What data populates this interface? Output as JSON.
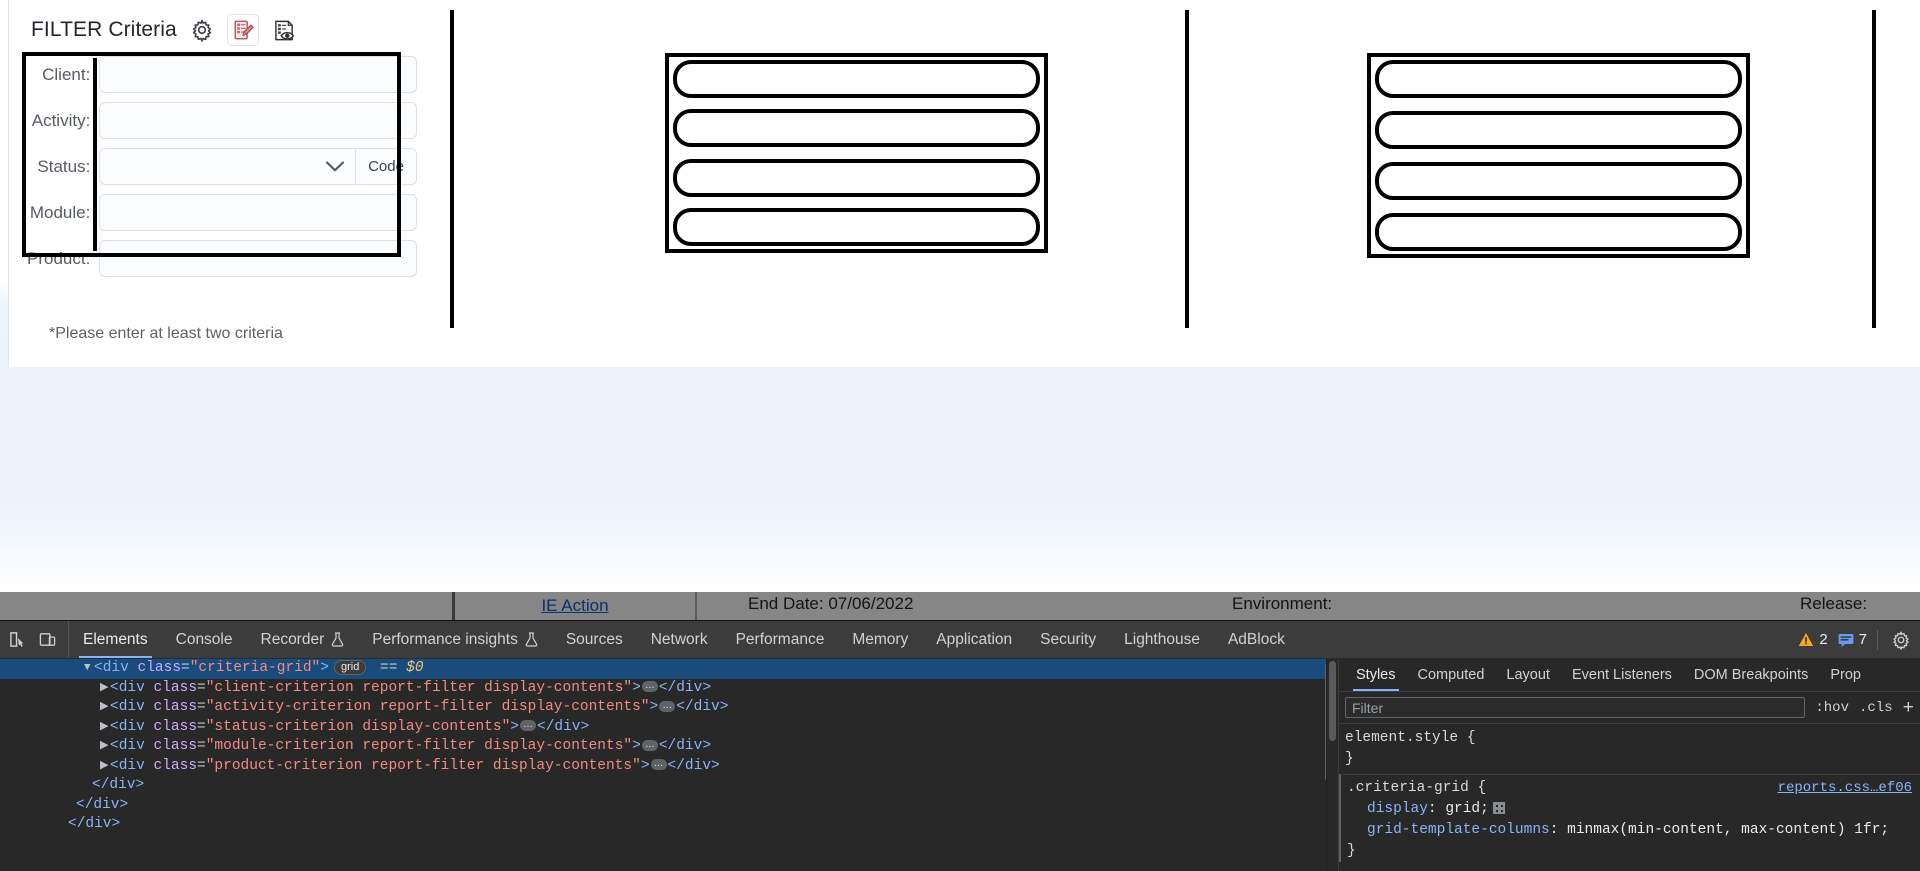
{
  "page": {
    "filter_panel": {
      "title": "FILTER Criteria",
      "icons": [
        {
          "name": "gear-icon",
          "label": "Settings"
        },
        {
          "name": "edit-report-icon",
          "label": "Edit"
        },
        {
          "name": "preview-report-icon",
          "label": "Preview"
        }
      ],
      "criteria": [
        {
          "label": "Client:",
          "type": "text",
          "value": "",
          "placeholder": ""
        },
        {
          "label": "Activity:",
          "type": "text",
          "value": "",
          "placeholder": ""
        },
        {
          "label": "Status:",
          "type": "select",
          "value": "",
          "placeholder": "",
          "code_label": "Code"
        },
        {
          "label": "Module:",
          "type": "text",
          "value": "",
          "placeholder": ""
        },
        {
          "label": "Product:",
          "type": "text",
          "value": "",
          "placeholder": ""
        }
      ],
      "note": "*Please enter at least two criteria"
    },
    "hidden_strip": {
      "ie_action": "IE Action",
      "end_date": "End Date: 07/06/2022",
      "environment": "Environment:",
      "release": "Release:"
    }
  },
  "devtools": {
    "tabs": [
      {
        "label": "Elements",
        "active": true,
        "flask": false
      },
      {
        "label": "Console",
        "active": false,
        "flask": false
      },
      {
        "label": "Recorder",
        "active": false,
        "flask": true
      },
      {
        "label": "Performance insights",
        "active": false,
        "flask": true
      },
      {
        "label": "Sources",
        "active": false,
        "flask": false
      },
      {
        "label": "Network",
        "active": false,
        "flask": false
      },
      {
        "label": "Performance",
        "active": false,
        "flask": false
      },
      {
        "label": "Memory",
        "active": false,
        "flask": false
      },
      {
        "label": "Application",
        "active": false,
        "flask": false
      },
      {
        "label": "Security",
        "active": false,
        "flask": false
      },
      {
        "label": "Lighthouse",
        "active": false,
        "flask": false
      },
      {
        "label": "AdBlock",
        "active": false,
        "flask": false
      }
    ],
    "counters": {
      "warnings": "2",
      "messages": "7"
    },
    "dom": {
      "lines": [
        {
          "indent": 10,
          "tri": true,
          "selected": true,
          "tag": "div",
          "attr": "class",
          "value": "criteria-grid",
          "badge": "grid",
          "suffix": " == $0",
          "self_close": false,
          "ellipsis": false
        },
        {
          "indent": 12,
          "tri": true,
          "selected": false,
          "tag": "div",
          "attr": "class",
          "value": "client-criterion report-filter display-contents",
          "ellipsis": true,
          "close": "</div>"
        },
        {
          "indent": 12,
          "tri": true,
          "selected": false,
          "tag": "div",
          "attr": "class",
          "value": "activity-criterion report-filter display-contents",
          "ellipsis": true,
          "close": "</div>"
        },
        {
          "indent": 12,
          "tri": true,
          "selected": false,
          "tag": "div",
          "attr": "class",
          "value": "status-criterion display-contents",
          "ellipsis": true,
          "close": "</div>"
        },
        {
          "indent": 12,
          "tri": true,
          "selected": false,
          "tag": "div",
          "attr": "class",
          "value": "module-criterion report-filter display-contents",
          "ellipsis": true,
          "close": "</div>"
        },
        {
          "indent": 12,
          "tri": true,
          "selected": false,
          "tag": "div",
          "attr": "class",
          "value": "product-criterion report-filter display-contents",
          "ellipsis": true,
          "close": "</div>"
        },
        {
          "indent": 11,
          "closeonly": "</div>"
        },
        {
          "indent": 9,
          "closeonly": "</div>"
        },
        {
          "indent": 8,
          "closeonly": "</div>"
        }
      ]
    },
    "styles": {
      "tabs": [
        {
          "label": "Styles",
          "active": true
        },
        {
          "label": "Computed",
          "active": false
        },
        {
          "label": "Layout",
          "active": false
        },
        {
          "label": "Event Listeners",
          "active": false
        },
        {
          "label": "DOM Breakpoints",
          "active": false
        },
        {
          "label": "Prop",
          "active": false
        }
      ],
      "filter_placeholder": "Filter",
      "filter_value": "",
      "pills": [
        ":hov",
        ".cls",
        "+"
      ],
      "rules": [
        {
          "selector": "element.style {",
          "source": "",
          "props": [],
          "close": "}"
        },
        {
          "selector": ".criteria-grid {",
          "source": "reports.css…ef06",
          "props": [
            {
              "name": "display",
              "value": "grid;",
              "swatch": "grid-swatch"
            },
            {
              "name": "grid-template-columns",
              "value": "minmax(min-content, max-content) 1fr;",
              "swatch": ""
            }
          ],
          "close": "}"
        }
      ]
    }
  },
  "colors": {
    "accent_blue": "#8ab4f8",
    "selected_row": "#1a4b7d",
    "devtools_bg": "#282828",
    "toolbar_bg": "#3c3c3c",
    "warning_orange": "#f5a623",
    "annotation_black": "#000000"
  }
}
